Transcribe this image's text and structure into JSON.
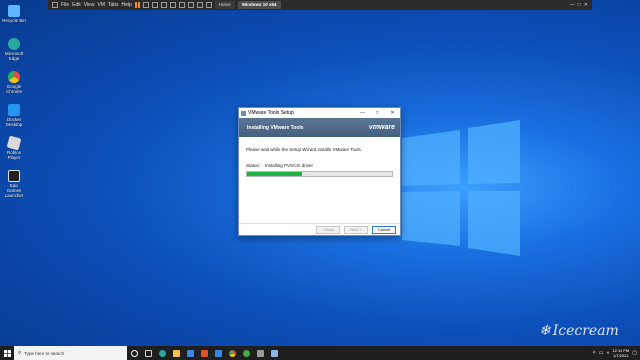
{
  "vm_toolbar": {
    "menus": [
      "File",
      "Edit",
      "View",
      "VM",
      "Tabs",
      "Help"
    ],
    "tabs": [
      "Home",
      "Windows 10 x64"
    ],
    "active_tab_index": 1
  },
  "desktop_icons": [
    {
      "label": "Recycle Bin",
      "icon": "recycle-bin-icon",
      "color": "#5fb6ff"
    },
    {
      "label": "Microsoft Edge",
      "icon": "edge-icon",
      "color": "#2aa8a0"
    },
    {
      "label": "Google Chrome",
      "icon": "chrome-icon",
      "color": "#e9b227"
    },
    {
      "label": "Docker Desktop",
      "icon": "docker-icon",
      "color": "#2496ed"
    },
    {
      "label": "Roblox Player",
      "icon": "roblox-icon",
      "color": "#d9d9d9"
    },
    {
      "label": "Epic Games Launcher",
      "icon": "epic-games-icon",
      "color": "#222222"
    }
  ],
  "dialog": {
    "title": "VMware Tools Setup",
    "minimize": "—",
    "maximize": "□",
    "close": "✕",
    "heading": "Installing VMware Tools",
    "brand": "vmware",
    "message": "Please wait while the Setup Wizard installs VMware Tools.",
    "status_label": "Status:",
    "status_value": "Installing PVSCSI driver",
    "progress": 0.38,
    "back_label": "< Back",
    "next_label": "Next >",
    "cancel_label": "Cancel"
  },
  "watermark": {
    "text": "Icecream"
  },
  "taskbar": {
    "search_placeholder": "Type here to search",
    "apps": [
      {
        "icon": "cortana-icon",
        "color": "#ffffff"
      },
      {
        "icon": "task-view-icon",
        "color": "#cfcfcf"
      },
      {
        "icon": "edge-icon",
        "color": "#2aa8a0"
      },
      {
        "icon": "file-explorer-icon",
        "color": "#f2c14e"
      },
      {
        "icon": "store-icon",
        "color": "#3a86e0"
      },
      {
        "icon": "office-icon",
        "color": "#e0502a"
      },
      {
        "icon": "mail-icon",
        "color": "#3a86e0"
      },
      {
        "icon": "chrome-icon",
        "color": "#e9b227"
      },
      {
        "icon": "xbox-icon",
        "color": "#3cb043"
      },
      {
        "icon": "vmware-icon",
        "color": "#9a9a9a"
      },
      {
        "icon": "notepad-icon",
        "color": "#8fb7e6"
      }
    ],
    "time": "12:11 PM",
    "date": "1/7/2021"
  }
}
